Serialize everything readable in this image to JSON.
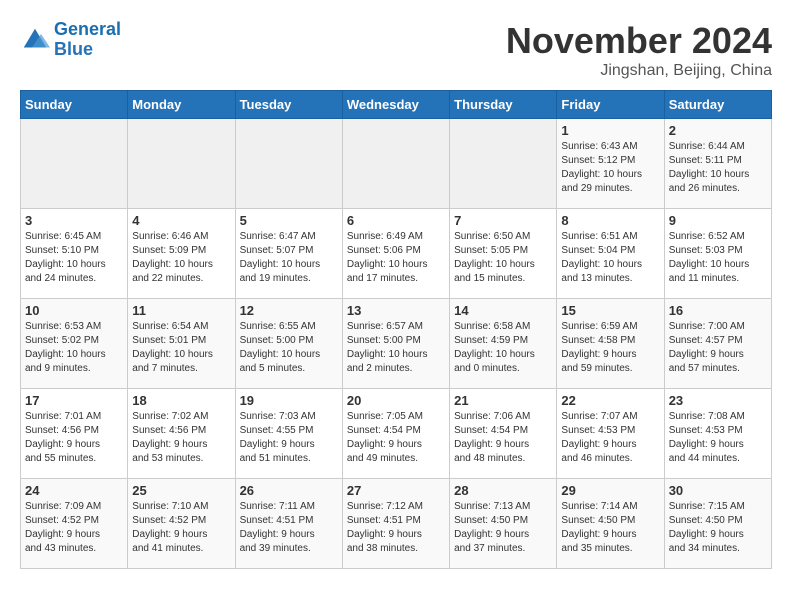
{
  "logo": {
    "line1": "General",
    "line2": "Blue"
  },
  "title": "November 2024",
  "subtitle": "Jingshan, Beijing, China",
  "weekdays": [
    "Sunday",
    "Monday",
    "Tuesday",
    "Wednesday",
    "Thursday",
    "Friday",
    "Saturday"
  ],
  "weeks": [
    [
      {
        "day": "",
        "info": ""
      },
      {
        "day": "",
        "info": ""
      },
      {
        "day": "",
        "info": ""
      },
      {
        "day": "",
        "info": ""
      },
      {
        "day": "",
        "info": ""
      },
      {
        "day": "1",
        "info": "Sunrise: 6:43 AM\nSunset: 5:12 PM\nDaylight: 10 hours\nand 29 minutes."
      },
      {
        "day": "2",
        "info": "Sunrise: 6:44 AM\nSunset: 5:11 PM\nDaylight: 10 hours\nand 26 minutes."
      }
    ],
    [
      {
        "day": "3",
        "info": "Sunrise: 6:45 AM\nSunset: 5:10 PM\nDaylight: 10 hours\nand 24 minutes."
      },
      {
        "day": "4",
        "info": "Sunrise: 6:46 AM\nSunset: 5:09 PM\nDaylight: 10 hours\nand 22 minutes."
      },
      {
        "day": "5",
        "info": "Sunrise: 6:47 AM\nSunset: 5:07 PM\nDaylight: 10 hours\nand 19 minutes."
      },
      {
        "day": "6",
        "info": "Sunrise: 6:49 AM\nSunset: 5:06 PM\nDaylight: 10 hours\nand 17 minutes."
      },
      {
        "day": "7",
        "info": "Sunrise: 6:50 AM\nSunset: 5:05 PM\nDaylight: 10 hours\nand 15 minutes."
      },
      {
        "day": "8",
        "info": "Sunrise: 6:51 AM\nSunset: 5:04 PM\nDaylight: 10 hours\nand 13 minutes."
      },
      {
        "day": "9",
        "info": "Sunrise: 6:52 AM\nSunset: 5:03 PM\nDaylight: 10 hours\nand 11 minutes."
      }
    ],
    [
      {
        "day": "10",
        "info": "Sunrise: 6:53 AM\nSunset: 5:02 PM\nDaylight: 10 hours\nand 9 minutes."
      },
      {
        "day": "11",
        "info": "Sunrise: 6:54 AM\nSunset: 5:01 PM\nDaylight: 10 hours\nand 7 minutes."
      },
      {
        "day": "12",
        "info": "Sunrise: 6:55 AM\nSunset: 5:00 PM\nDaylight: 10 hours\nand 5 minutes."
      },
      {
        "day": "13",
        "info": "Sunrise: 6:57 AM\nSunset: 5:00 PM\nDaylight: 10 hours\nand 2 minutes."
      },
      {
        "day": "14",
        "info": "Sunrise: 6:58 AM\nSunset: 4:59 PM\nDaylight: 10 hours\nand 0 minutes."
      },
      {
        "day": "15",
        "info": "Sunrise: 6:59 AM\nSunset: 4:58 PM\nDaylight: 9 hours\nand 59 minutes."
      },
      {
        "day": "16",
        "info": "Sunrise: 7:00 AM\nSunset: 4:57 PM\nDaylight: 9 hours\nand 57 minutes."
      }
    ],
    [
      {
        "day": "17",
        "info": "Sunrise: 7:01 AM\nSunset: 4:56 PM\nDaylight: 9 hours\nand 55 minutes."
      },
      {
        "day": "18",
        "info": "Sunrise: 7:02 AM\nSunset: 4:56 PM\nDaylight: 9 hours\nand 53 minutes."
      },
      {
        "day": "19",
        "info": "Sunrise: 7:03 AM\nSunset: 4:55 PM\nDaylight: 9 hours\nand 51 minutes."
      },
      {
        "day": "20",
        "info": "Sunrise: 7:05 AM\nSunset: 4:54 PM\nDaylight: 9 hours\nand 49 minutes."
      },
      {
        "day": "21",
        "info": "Sunrise: 7:06 AM\nSunset: 4:54 PM\nDaylight: 9 hours\nand 48 minutes."
      },
      {
        "day": "22",
        "info": "Sunrise: 7:07 AM\nSunset: 4:53 PM\nDaylight: 9 hours\nand 46 minutes."
      },
      {
        "day": "23",
        "info": "Sunrise: 7:08 AM\nSunset: 4:53 PM\nDaylight: 9 hours\nand 44 minutes."
      }
    ],
    [
      {
        "day": "24",
        "info": "Sunrise: 7:09 AM\nSunset: 4:52 PM\nDaylight: 9 hours\nand 43 minutes."
      },
      {
        "day": "25",
        "info": "Sunrise: 7:10 AM\nSunset: 4:52 PM\nDaylight: 9 hours\nand 41 minutes."
      },
      {
        "day": "26",
        "info": "Sunrise: 7:11 AM\nSunset: 4:51 PM\nDaylight: 9 hours\nand 39 minutes."
      },
      {
        "day": "27",
        "info": "Sunrise: 7:12 AM\nSunset: 4:51 PM\nDaylight: 9 hours\nand 38 minutes."
      },
      {
        "day": "28",
        "info": "Sunrise: 7:13 AM\nSunset: 4:50 PM\nDaylight: 9 hours\nand 37 minutes."
      },
      {
        "day": "29",
        "info": "Sunrise: 7:14 AM\nSunset: 4:50 PM\nDaylight: 9 hours\nand 35 minutes."
      },
      {
        "day": "30",
        "info": "Sunrise: 7:15 AM\nSunset: 4:50 PM\nDaylight: 9 hours\nand 34 minutes."
      }
    ]
  ]
}
